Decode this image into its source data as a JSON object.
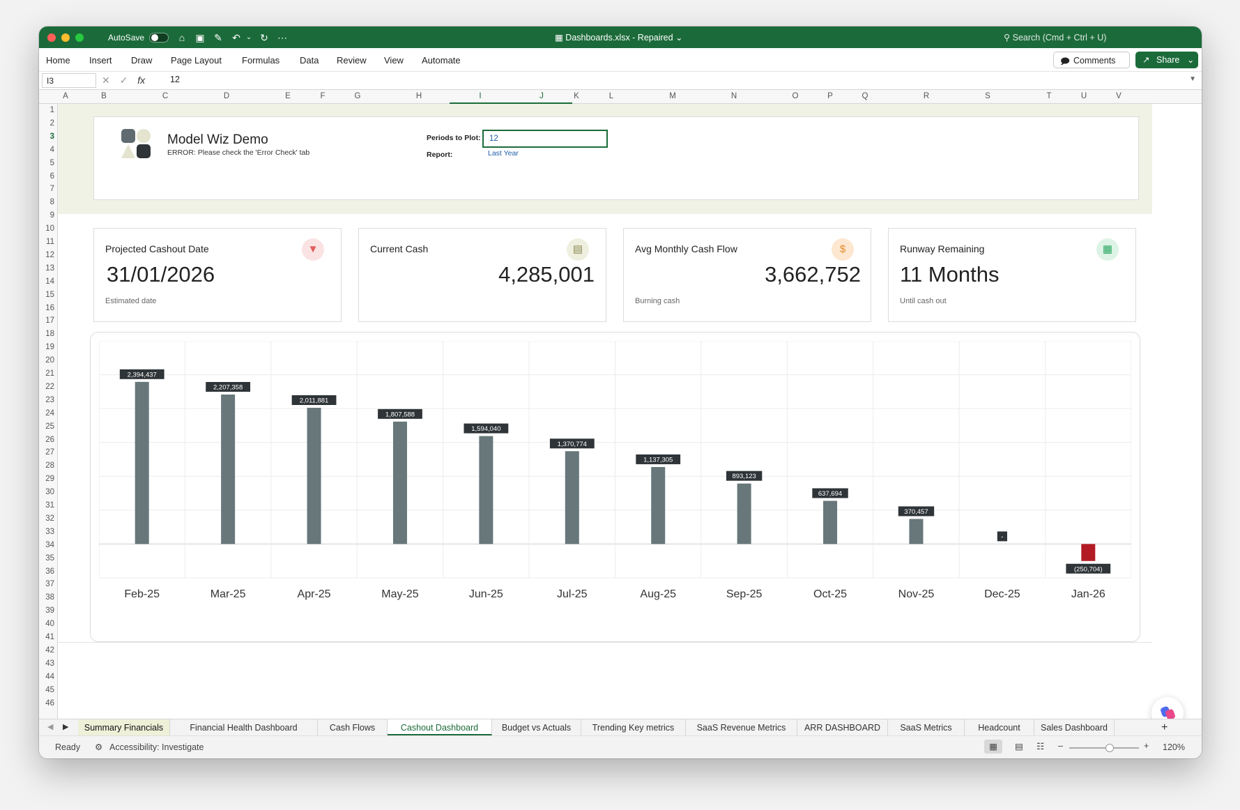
{
  "titlebar": {
    "autosave_label": "AutoSave",
    "document_title": "Dashboards.xlsx  -  Repaired",
    "search_placeholder": "Search (Cmd + Ctrl + U)"
  },
  "ribbon": {
    "tabs": [
      "Home",
      "Insert",
      "Draw",
      "Page Layout",
      "Formulas",
      "Data",
      "Review",
      "View",
      "Automate"
    ],
    "comments_label": "Comments",
    "share_label": "Share"
  },
  "formula_bar": {
    "name_box": "I3",
    "fx_label": "fx",
    "formula_value": "12"
  },
  "columns": [
    "A",
    "B",
    "C",
    "D",
    "E",
    "F",
    "G",
    "H",
    "I",
    "J",
    "K",
    "L",
    "M",
    "N",
    "O",
    "P",
    "Q",
    "R",
    "S",
    "T",
    "U",
    "V"
  ],
  "rows": [
    "1",
    "2",
    "3",
    "4",
    "5",
    "6",
    "7",
    "8",
    "9",
    "10",
    "11",
    "12",
    "13",
    "14",
    "15",
    "16",
    "17",
    "18",
    "19",
    "20",
    "21",
    "22",
    "23",
    "24",
    "25",
    "26",
    "27",
    "28",
    "29",
    "30",
    "31",
    "32",
    "33",
    "34",
    "35",
    "36",
    "37",
    "38",
    "39",
    "40",
    "41",
    "42",
    "43",
    "44",
    "45",
    "46"
  ],
  "dashboard": {
    "company_name": "Model Wiz Demo",
    "error_message": "ERROR: Please check the 'Error Check' tab",
    "periods_label": "Periods to Plot:",
    "periods_value": "12",
    "report_label": "Report:",
    "report_value": "Last Year",
    "kpis": [
      {
        "title": "Projected Cashout Date",
        "value": "31/01/2026",
        "subtitle": "Estimated date",
        "icon": "cashout-icon",
        "color": "#e05a5a"
      },
      {
        "title": "Current Cash",
        "value": "4,285,001",
        "subtitle": "",
        "icon": "cash-icon",
        "color": "#8a8a55"
      },
      {
        "title": "Avg Monthly Cash Flow",
        "value": "3,662,752",
        "subtitle": "Burning cash",
        "icon": "dollar-icon",
        "color": "#e38a2a"
      },
      {
        "title": "Runway Remaining",
        "value": "11 Months",
        "subtitle": "Until cash out",
        "icon": "calendar-icon",
        "color": "#2aa861"
      }
    ]
  },
  "chart_data": {
    "type": "bar",
    "categories": [
      "Feb-25",
      "Mar-25",
      "Apr-25",
      "May-25",
      "Jun-25",
      "Jul-25",
      "Aug-25",
      "Sep-25",
      "Oct-25",
      "Nov-25",
      "Dec-25",
      "Jan-26"
    ],
    "values": [
      2394437,
      2207358,
      2011881,
      1807588,
      1594040,
      1370774,
      1137305,
      893123,
      637694,
      370457,
      0,
      -250704
    ],
    "data_labels": [
      "2,394,437",
      "2,207,358",
      "2,011,881",
      "1,807,588",
      "1,594,040",
      "1,370,774",
      "1,137,305",
      "893,123",
      "637,694",
      "370,457",
      "-",
      "(250,704)"
    ],
    "ylim": [
      -500000,
      3000000
    ],
    "grid": true,
    "colors": {
      "positive": "#67777a",
      "negative": "#b31b24",
      "label_bg": "#2e3437"
    }
  },
  "sheet_tabs": [
    "Summary Financials",
    "Financial Health Dashboard",
    "Cash Flows",
    "Cashout Dashboard",
    "Budget vs Actuals",
    "Trending Key metrics",
    "SaaS Revenue Metrics",
    "ARR DASHBOARD",
    "SaaS Metrics",
    "Headcount",
    "Sales Dashboard"
  ],
  "active_tab": "Cashout Dashboard",
  "statusbar": {
    "ready": "Ready",
    "accessibility": "Accessibility: Investigate",
    "zoom": "120%"
  },
  "colors": {
    "excel_green": "#1b6b3a",
    "link_blue": "#1f5ea8"
  }
}
